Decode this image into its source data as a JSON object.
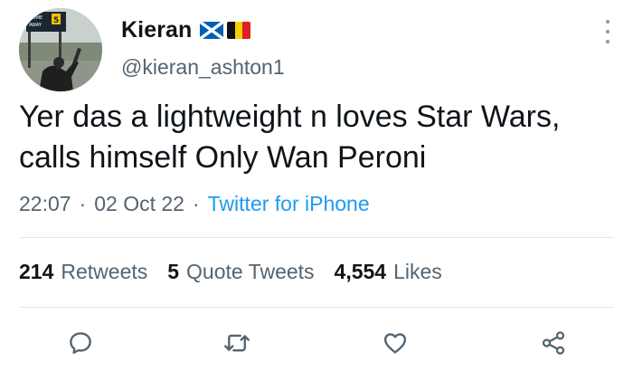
{
  "user": {
    "display_name": "Kieran",
    "handle": "@kieran_ashton1",
    "flags": [
      "scotland-flag",
      "belgium-flag"
    ]
  },
  "tweet": {
    "text": "Yer das a lightweight n loves Star Wars, calls himself Only Wan Peroni",
    "time": "22:07",
    "date": "02 Oct 22",
    "separator": "·",
    "source": "Twitter for iPhone"
  },
  "avatar": {
    "scoreboard_text": [
      "HOME",
      "AWAY"
    ],
    "scoreboard_digit": "5"
  },
  "stats": [
    {
      "count": "214",
      "label": "Retweets"
    },
    {
      "count": "5",
      "label": "Quote Tweets"
    },
    {
      "count": "4,554",
      "label": "Likes"
    }
  ],
  "actions": [
    "reply-icon",
    "retweet-icon",
    "like-icon",
    "share-icon"
  ],
  "colors": {
    "text": "#0f1419",
    "secondary": "#536471",
    "link": "#1d9bf0",
    "divider": "#e1e8ed"
  }
}
